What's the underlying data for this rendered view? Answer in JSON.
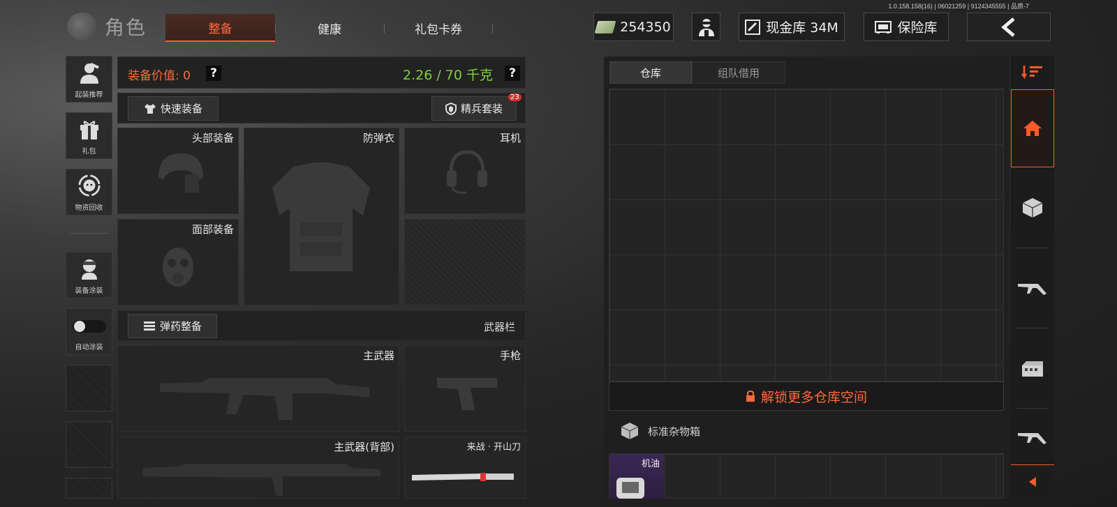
{
  "version_info": "1.0.158.158(16) | 06021259 | 9124345555 | 品质-7",
  "header": {
    "title": "角色",
    "tabs": [
      {
        "label": "整备",
        "active": true
      },
      {
        "label": "健康",
        "active": false
      },
      {
        "label": "礼包卡券",
        "active": false
      }
    ],
    "currency": "254350",
    "cash_vault": "现金库 34M",
    "safe_box": "保险库"
  },
  "left_rail": {
    "items": [
      {
        "label": "起装推荐",
        "icon": "armored-soldier-icon"
      },
      {
        "label": "礼包",
        "icon": "gift-icon"
      },
      {
        "label": "物资回收",
        "icon": "recycle-icon"
      },
      {
        "label": "装备涂装",
        "icon": "soldier-paint-icon"
      },
      {
        "label": "自动涂装",
        "icon": "toggle-icon"
      }
    ]
  },
  "equipment": {
    "value_label": "装备价值: 0",
    "weight": "2.26 / 70 千克",
    "quick_equip": "快速装备",
    "elite_set": "精兵套装",
    "elite_badge": "23",
    "slots": {
      "head": "头部装备",
      "armor": "防弹衣",
      "headset": "耳机",
      "face": "面部装备",
      "ammo_btn": "弹药整备",
      "weapon_bar": "武器栏",
      "primary": "主武器",
      "pistol": "手枪",
      "primary_back": "主武器(背部)",
      "melee": "来战 · 开山刀"
    }
  },
  "storage": {
    "tabs": [
      {
        "label": "仓库",
        "active": true
      },
      {
        "label": "组队借用",
        "active": false
      }
    ],
    "unlock": "解锁更多仓库空间",
    "box_label": "标准杂物箱",
    "item_label": "机油"
  },
  "colors": {
    "accent": "#ff5a2a",
    "weight_green": "#7fd13b",
    "value_orange": "#ff6a3a",
    "item_purple": "#3b2756"
  }
}
